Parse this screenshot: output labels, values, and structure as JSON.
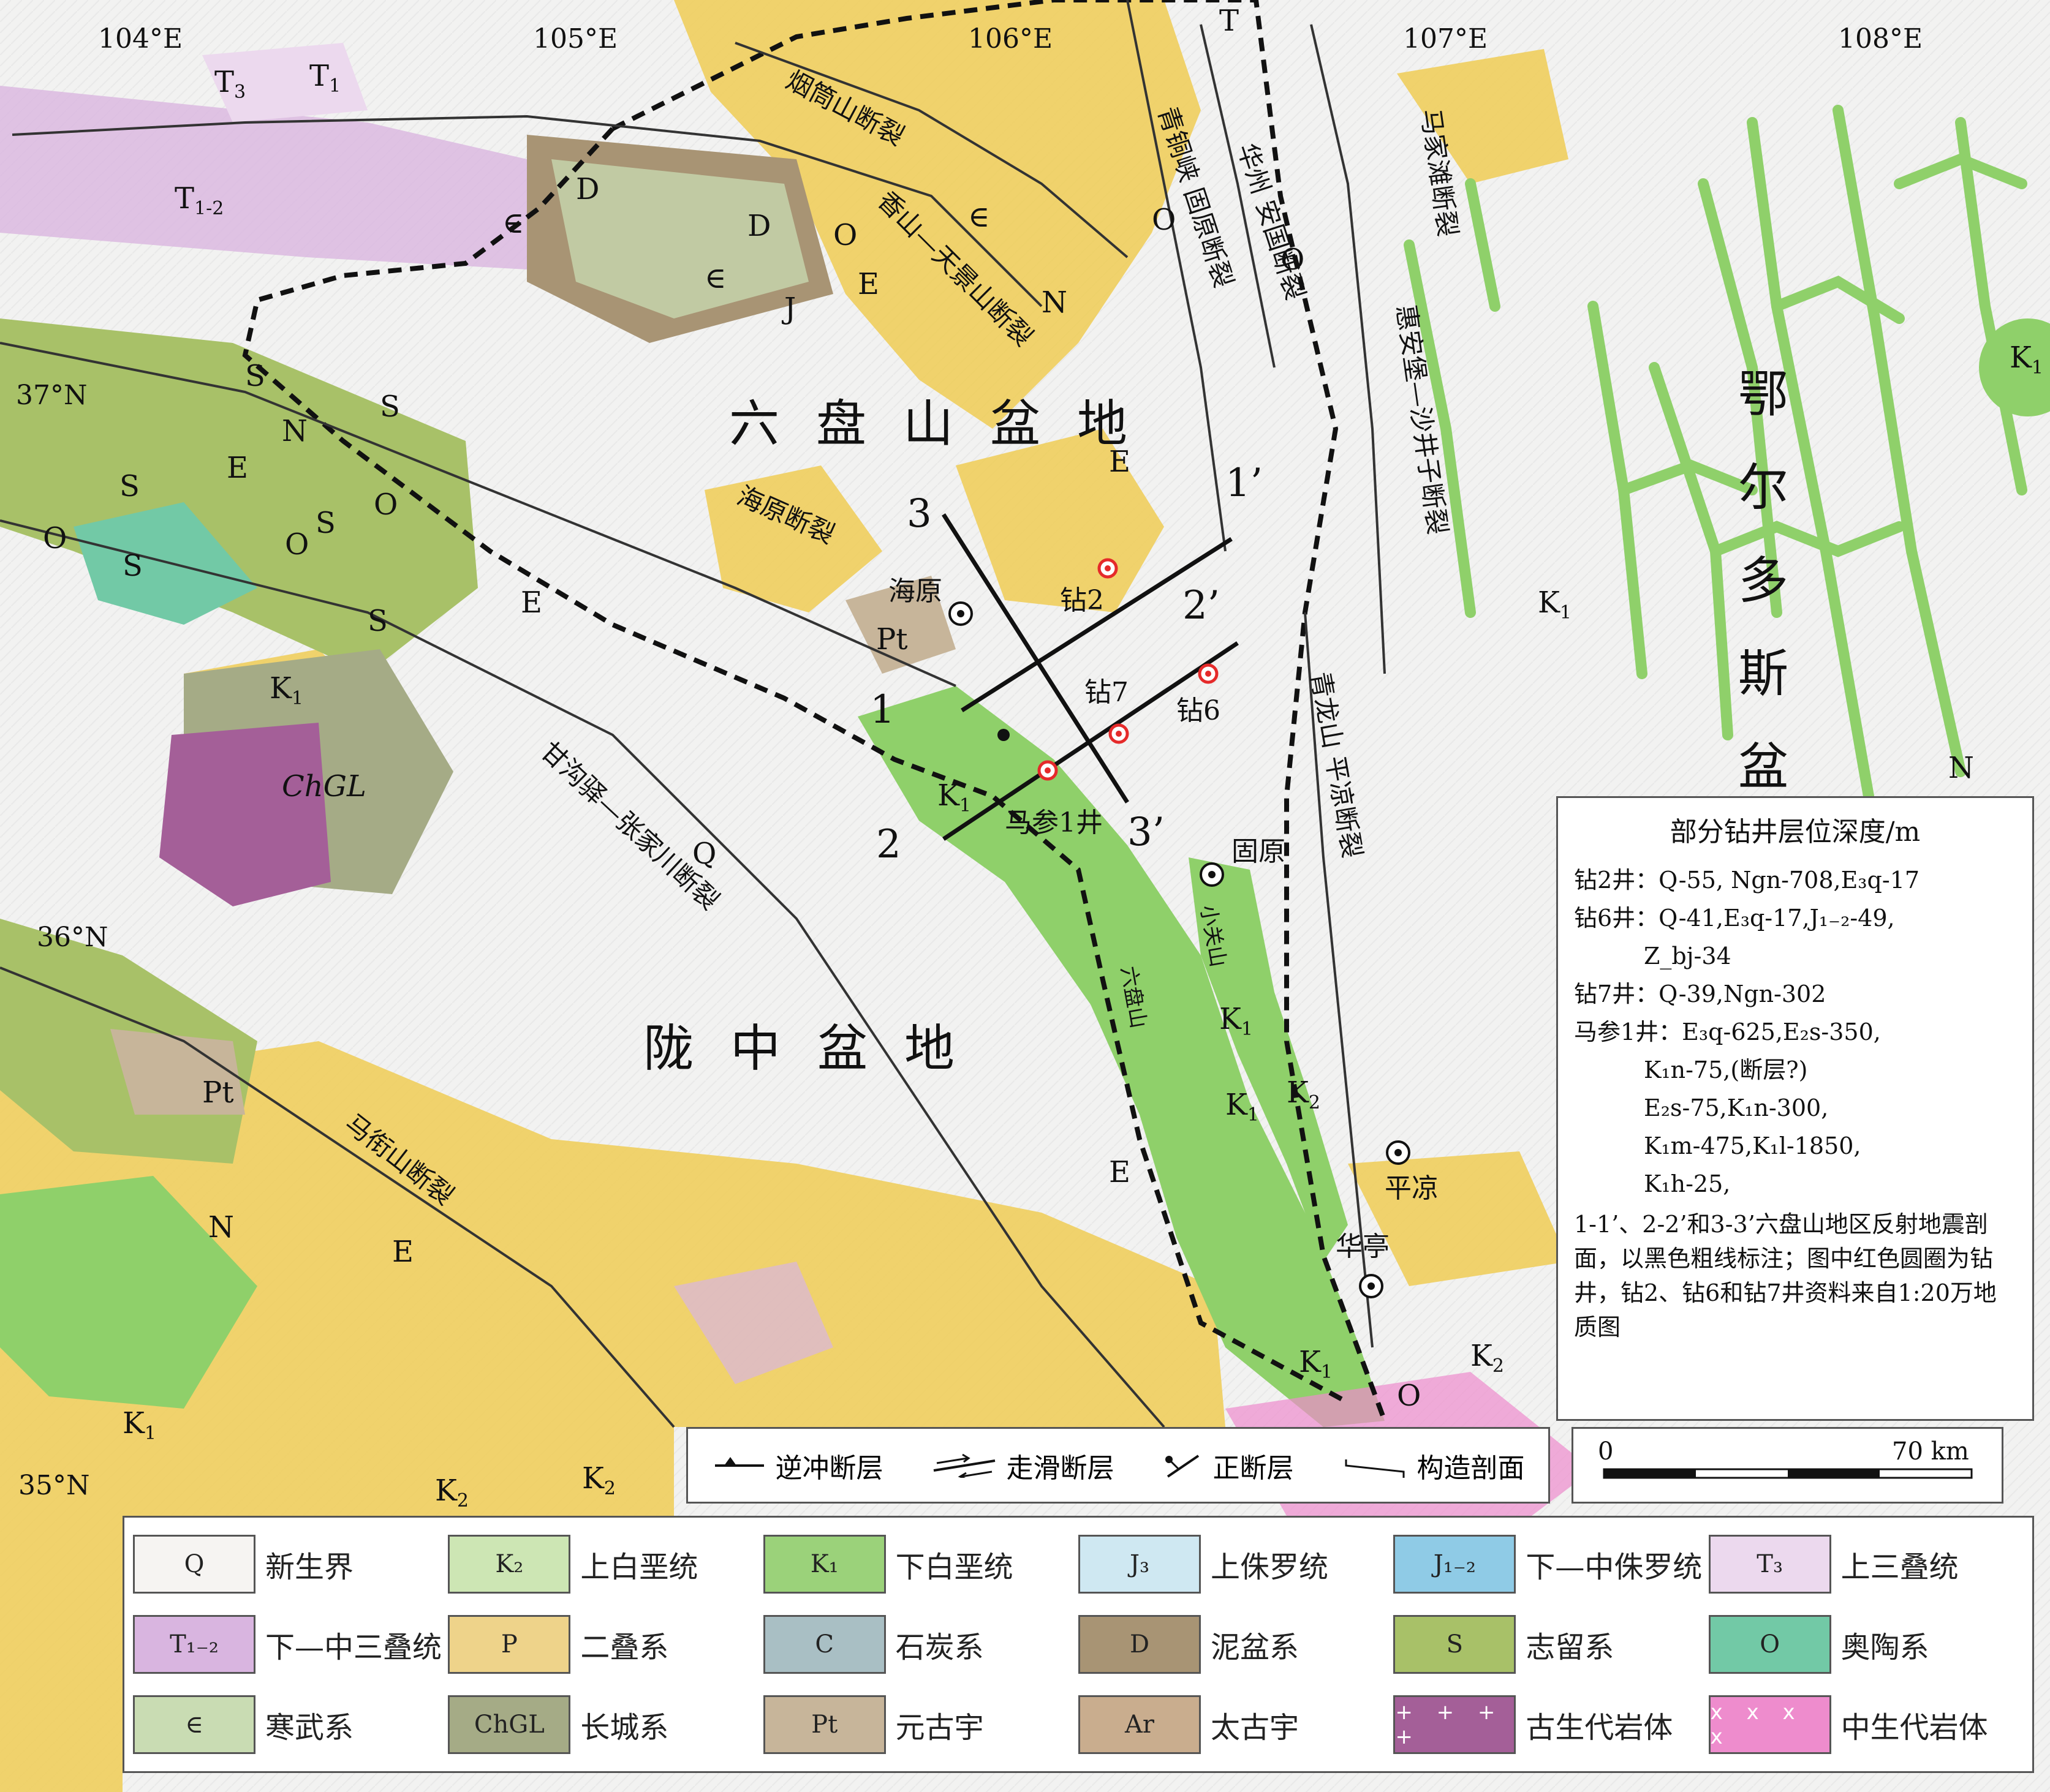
{
  "coords": {
    "lon_labels": [
      "104°E",
      "105°E",
      "106°E",
      "107°E",
      "108°E"
    ],
    "lat_labels": [
      "37°N",
      "36°N",
      "35°N"
    ]
  },
  "basins": {
    "liupanshan": "六盘山盆地",
    "longzhong": "陇中盆地",
    "ordos": "鄂尔多斯盆地"
  },
  "faults": {
    "yantongshan": "烟筒山断裂",
    "xiangshan": "香山—天景山断裂",
    "qingtongxia": "青铜峡 固原断裂",
    "huazhou": "华州 安国断裂",
    "majiatan": "马家滩断裂",
    "huianbao": "惠安堡—沙井子断裂",
    "haiyuan": "海原断裂",
    "ganguyi": "甘沟驿—张家川断裂",
    "qinglongshan": "青龙山 平凉断裂",
    "maxianshan": "马衔山断裂",
    "liupanshan_mtn": "六盘山",
    "xiaoguanshan": "小关山"
  },
  "places": {
    "haiyuan": "海原",
    "guyuan": "固原",
    "pingliang": "平凉",
    "huating": "华亭"
  },
  "wells": {
    "zuan2": "钻2",
    "zuan6": "钻6",
    "zuan7": "钻7",
    "macan1": "马参1井"
  },
  "sections": {
    "s1": "1",
    "s1p": "1’",
    "s2": "2",
    "s2p": "2’",
    "s3": "3",
    "s3p": "3’"
  },
  "units_on_map": {
    "q": "Q",
    "e": "E",
    "n": "N",
    "o": "O",
    "s": "S",
    "d": "D",
    "camb": "∈",
    "t": "T",
    "j": "J",
    "pt": "Pt",
    "chgl": "ChGL"
  },
  "depth_box": {
    "title": "部分钻井层位深度/m",
    "rows": [
      "钻2井：Q-55, Ngn-708,E₃q-17",
      "钻6井：Q-41,E₃q-17,J₁₋₂-49,",
      "　　　Z_bj-34",
      "钻7井：Q-39,Ngn-302",
      "马参1井：E₃q-625,E₂s-350,",
      "　　　K₁n-75,(断层?)",
      "　　　E₂s-75,K₁n-300,",
      "　　　K₁m-475,K₁l-1850,",
      "　　　K₁h-25,"
    ],
    "note": "1-1’、2-2’和3-3’六盘山地区反射地震剖面，以黑色粗线标注；图中红色圆圈为钻井，钻2、钻6和钻7井资料来自1:20万地质图"
  },
  "fault_legend": {
    "thrust": "逆冲断层",
    "strike_slip": "走滑断层",
    "normal": "正断层",
    "section": "构造剖面"
  },
  "scale": {
    "zero": "0",
    "max": "70 km"
  },
  "unit_legend": [
    {
      "code": "Q",
      "name": "新生界",
      "color": "#f6f4f2"
    },
    {
      "code": "K₂",
      "name": "上白垩统",
      "color": "#cde6b4"
    },
    {
      "code": "K₁",
      "name": "下白垩统",
      "color": "#9bd27a"
    },
    {
      "code": "J₃",
      "name": "上侏罗统",
      "color": "#cfe8f2"
    },
    {
      "code": "J₁₋₂",
      "name": "下—中侏罗统",
      "color": "#8fcbe6"
    },
    {
      "code": "T₃",
      "name": "上三叠统",
      "color": "#ecd9ee"
    },
    {
      "code": "T₁₋₂",
      "name": "下—中三叠统",
      "color": "#d9b5e0"
    },
    {
      "code": "P",
      "name": "二叠系",
      "color": "#eed38a"
    },
    {
      "code": "C",
      "name": "石炭系",
      "color": "#a9bfc4"
    },
    {
      "code": "D",
      "name": "泥盆系",
      "color": "#a89474"
    },
    {
      "code": "S",
      "name": "志留系",
      "color": "#a8c168"
    },
    {
      "code": "O",
      "name": "奥陶系",
      "color": "#72c9a6"
    },
    {
      "code": "∈",
      "name": "寒武系",
      "color": "#c9dcb3"
    },
    {
      "code": "ChGL",
      "name": "长城系",
      "color": "#a5ab86"
    },
    {
      "code": "Pt",
      "name": "元古宇",
      "color": "#c7b59a"
    },
    {
      "code": "Ar",
      "name": "太古宇",
      "color": "#c9ad8e"
    },
    {
      "code": "",
      "name": "古生代岩体",
      "color": "#a45f98",
      "pattern": "+"
    },
    {
      "code": "",
      "name": "中生代岩体",
      "color": "#ee8ccd",
      "pattern": "x"
    }
  ],
  "colors": {
    "paleogene": "#f0cd55",
    "k1": "#8fd06a",
    "basin_boundary": "#111111",
    "well_marker": "#e52a2a"
  }
}
